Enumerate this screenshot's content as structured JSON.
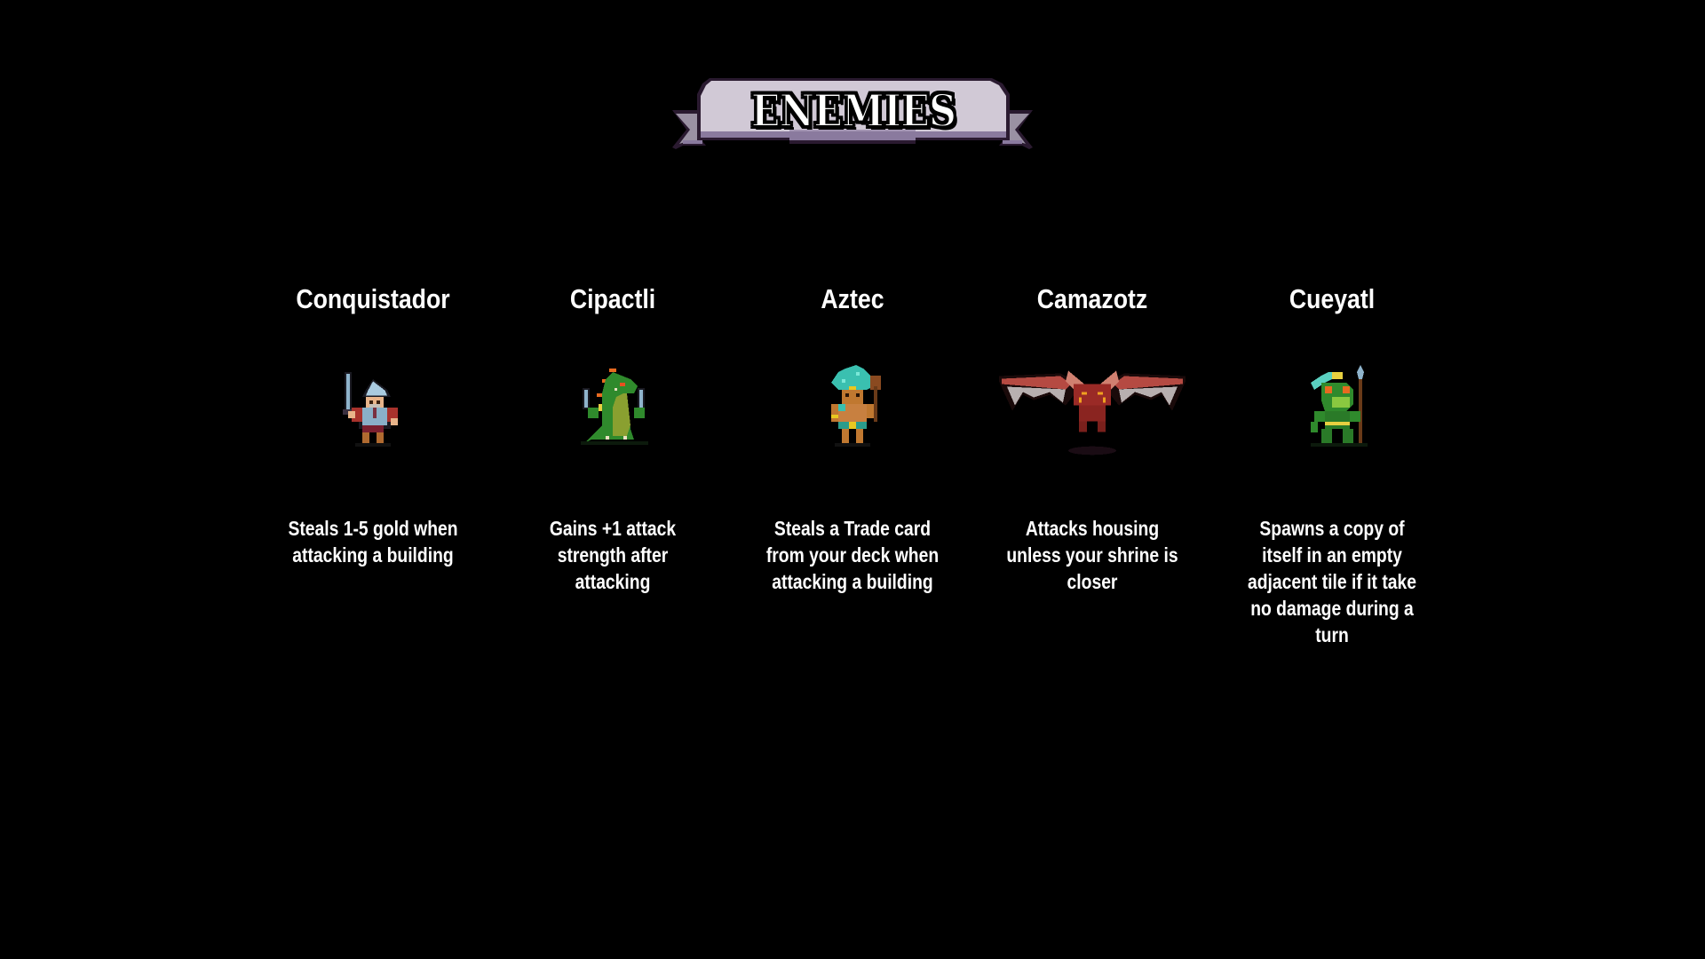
{
  "page": {
    "title": "ENEMIES",
    "background_color": "#000000"
  },
  "banner": {
    "label": "ENEMIES",
    "colors": {
      "body": "#d1c9d6",
      "shade": "#8a7a9e",
      "outline": "#2a1a30",
      "tail": "#9a91a3"
    }
  },
  "enemies": [
    {
      "name": "Conquistador",
      "sprite_icon": "conquistador-sprite-icon",
      "description": "Steals 1-5 gold when attacking a building"
    },
    {
      "name": "Cipactli",
      "sprite_icon": "cipactli-sprite-icon",
      "description": "Gains +1 attack strength after attacking"
    },
    {
      "name": "Aztec",
      "sprite_icon": "aztec-sprite-icon",
      "description": "Steals a Trade card from your deck when attacking a building"
    },
    {
      "name": "Camazotz",
      "sprite_icon": "camazotz-sprite-icon",
      "description": "Attacks housing unless your shrine is closer"
    },
    {
      "name": "Cueyatl",
      "sprite_icon": "cueyatl-sprite-icon",
      "description": "Spawns a copy of itself in an empty adjacent tile if it take no damage during a turn"
    }
  ]
}
